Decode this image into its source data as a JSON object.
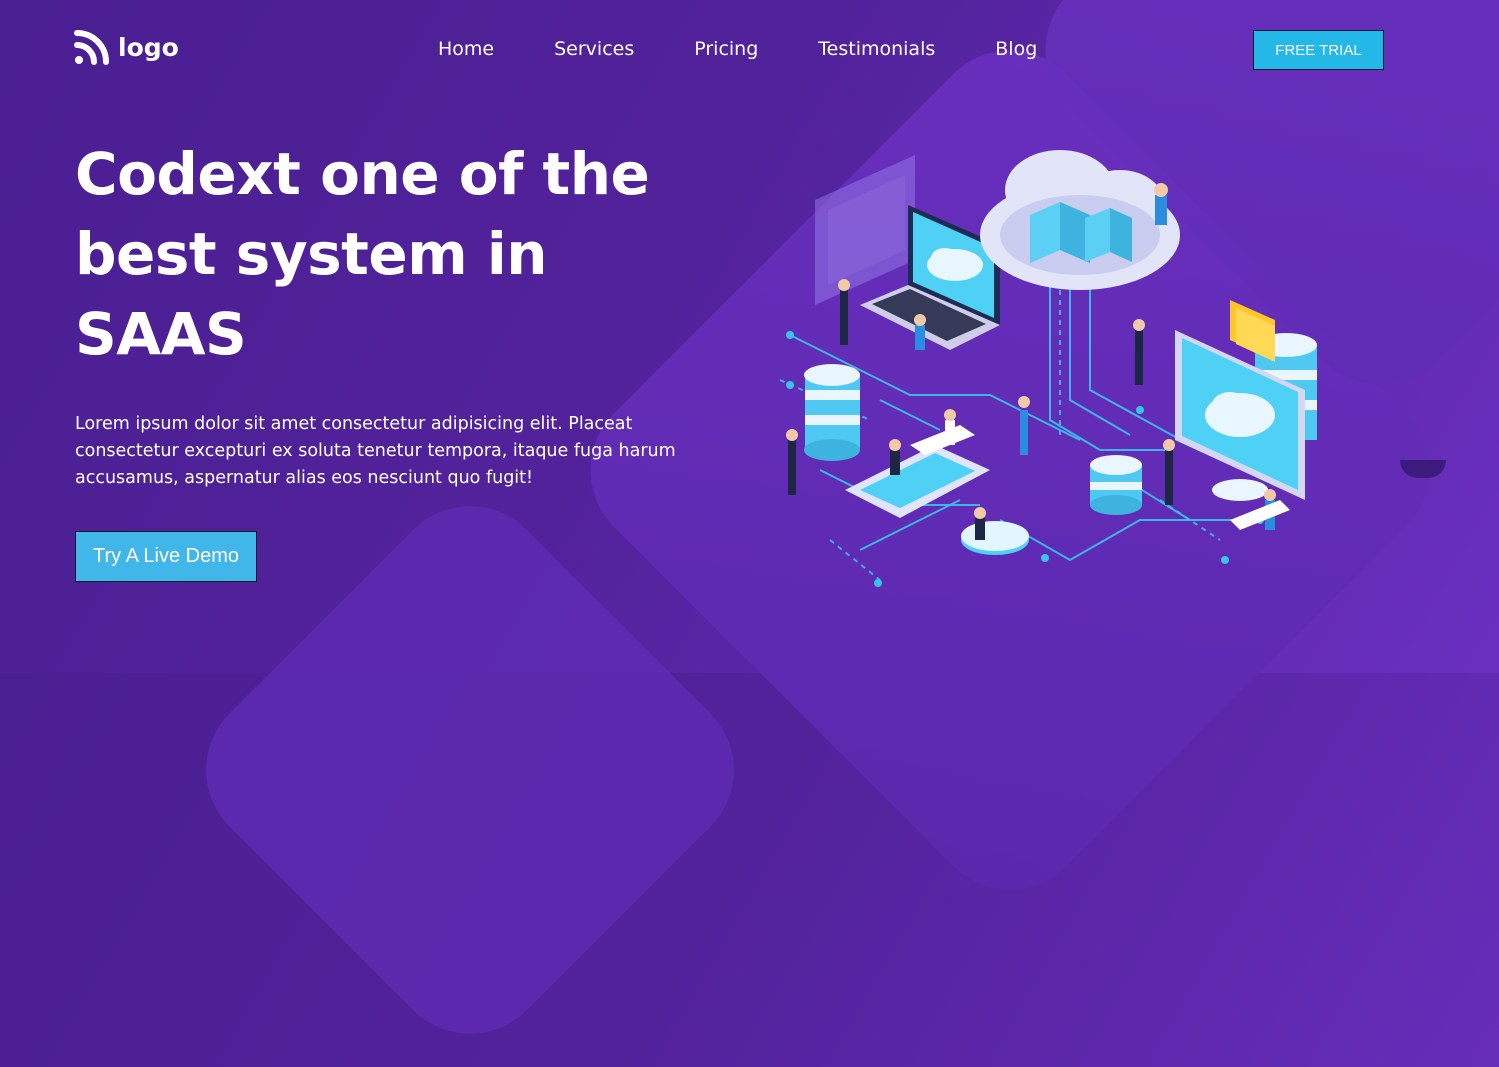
{
  "brand": {
    "logo_text": "logo",
    "logo_icon": "wifi-signal-icon"
  },
  "nav": {
    "items": [
      {
        "label": "Home"
      },
      {
        "label": "Services"
      },
      {
        "label": "Pricing"
      },
      {
        "label": "Testimonials"
      },
      {
        "label": "Blog"
      }
    ]
  },
  "cta_trial": {
    "label": "FREE TRIAL"
  },
  "hero": {
    "title": "Codext one of the best system in SAAS",
    "description": "Lorem ipsum dolor sit amet consectetur adipisicing elit. Placeat consectetur excepturi ex soluta tenetur tempora, itaque fuga harum accusamus, aspernatur alias eos nesciunt quo fugit!",
    "button_label": "Try A Live Demo"
  },
  "colors": {
    "background_start": "#4a1f92",
    "background_end": "#6a2fbf",
    "accent": "#24b8e8",
    "button_demo": "#41b6e8"
  },
  "illustration": {
    "name": "isometric-cloud-network-illustration"
  }
}
